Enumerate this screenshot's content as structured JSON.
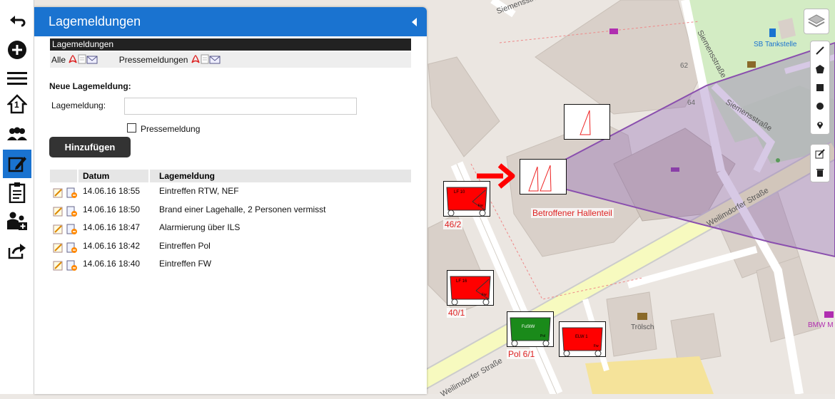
{
  "panel": {
    "title": "Lagemeldungen"
  },
  "section_bar": "Lagemeldungen",
  "filters": {
    "all": "Alle",
    "press": "Pressemeldungen"
  },
  "form": {
    "title": "Neue Lagemeldung:",
    "label": "Lagemeldung:",
    "input_value": "",
    "press_label": "Pressemeldung",
    "press_checked": false,
    "add_button": "Hinzufügen"
  },
  "table": {
    "headers": [
      "Datum",
      "Lagemeldung"
    ],
    "rows": [
      {
        "date": "14.06.16 18:55",
        "msg": "Eintreffen RTW, NEF"
      },
      {
        "date": "14.06.16 18:50",
        "msg": "Brand einer Lagehalle, 2 Personen vermisst"
      },
      {
        "date": "14.06.16 18:47",
        "msg": "Alarmierung über ILS"
      },
      {
        "date": "14.06.16 18:42",
        "msg": "Eintreffen Pol"
      },
      {
        "date": "14.06.16 18:40",
        "msg": "Eintreffen FW"
      }
    ]
  },
  "sidebar": {
    "items": [
      "back-icon",
      "add-icon",
      "menu-icon",
      "house-1-icon",
      "group-icon",
      "edit-icon",
      "clipboard-icon",
      "people-plus-icon",
      "share-icon"
    ],
    "home_number": "1"
  },
  "map": {
    "streets": [
      "Siemensstraße",
      "Siemensstraße",
      "Siemensstraße",
      "Weilimdorfer Straße",
      "Weilimdorfer Straße"
    ],
    "house_numbers": [
      "62",
      "64"
    ],
    "pois": [
      "SB Tankstelle",
      "Trölsch",
      "BMW M"
    ],
    "area_label": "Betroffener Hallenteil",
    "vehicles": [
      {
        "name": "LF 10",
        "label": "46/2",
        "color": "#ff0000"
      },
      {
        "name": "LF 16",
        "label": "40/1",
        "color": "#ff0000"
      },
      {
        "name": "FuStW",
        "label": "Pol 6/1",
        "color": "#1a8a1a"
      },
      {
        "name": "ELW 1",
        "label": "",
        "color": "#ff0000"
      }
    ],
    "vehicle_tags": [
      "Fw",
      "Fw",
      "Pol",
      "Fw"
    ],
    "accent_colors": {
      "header": "#1a73d0",
      "area": "#8a4fae",
      "arrow": "#ff0000"
    }
  }
}
